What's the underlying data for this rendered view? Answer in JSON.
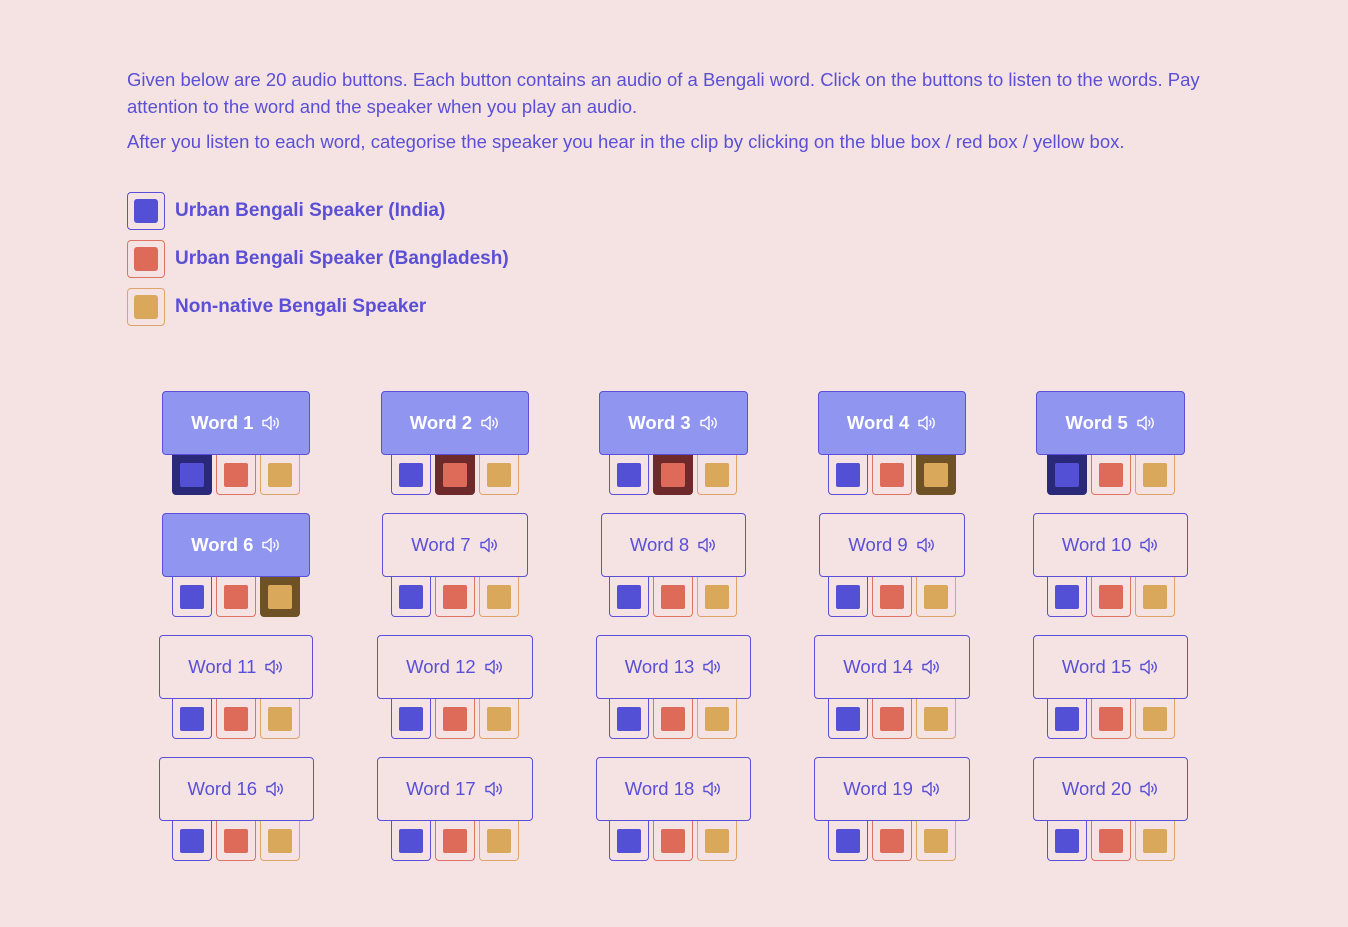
{
  "instructions": {
    "p1": "Given below are 20 audio buttons. Each button contains an audio of a Bengali word. Click on the buttons to listen to the words. Pay attention to the word and the speaker when you play an audio.",
    "p2": "After you listen to each word, categorise the speaker you hear in the clip by clicking on the blue box / red box / yellow box."
  },
  "legend": [
    {
      "label": "Urban Bengali Speaker (India)",
      "color": "#5450d6",
      "border": "#5a4fd6"
    },
    {
      "label": "Urban Bengali Speaker (Bangladesh)",
      "color": "#de6a5a",
      "border": "#e07464"
    },
    {
      "label": "Non-native Bengali Speaker",
      "color": "#d9a85a",
      "border": "#dfa46a"
    }
  ],
  "colors": {
    "played_bg": "#9096ef",
    "accent": "#5a4fd6",
    "background": "#f5e3e3"
  },
  "words": [
    {
      "label": "Word 1",
      "played": true,
      "selected": "blue"
    },
    {
      "label": "Word 2",
      "played": true,
      "selected": "red"
    },
    {
      "label": "Word 3",
      "played": true,
      "selected": "red"
    },
    {
      "label": "Word 4",
      "played": true,
      "selected": "yellow"
    },
    {
      "label": "Word 5",
      "played": true,
      "selected": "blue"
    },
    {
      "label": "Word 6",
      "played": true,
      "selected": "yellow"
    },
    {
      "label": "Word 7",
      "played": false,
      "selected": null
    },
    {
      "label": "Word 8",
      "played": false,
      "selected": null
    },
    {
      "label": "Word 9",
      "played": false,
      "selected": null
    },
    {
      "label": "Word 10",
      "played": false,
      "selected": null
    },
    {
      "label": "Word 11",
      "played": false,
      "selected": null
    },
    {
      "label": "Word 12",
      "played": false,
      "selected": null
    },
    {
      "label": "Word 13",
      "played": false,
      "selected": null
    },
    {
      "label": "Word 14",
      "played": false,
      "selected": null
    },
    {
      "label": "Word 15",
      "played": false,
      "selected": null
    },
    {
      "label": "Word 16",
      "played": false,
      "selected": null
    },
    {
      "label": "Word 17",
      "played": false,
      "selected": null
    },
    {
      "label": "Word 18",
      "played": false,
      "selected": null
    },
    {
      "label": "Word 19",
      "played": false,
      "selected": null
    },
    {
      "label": "Word 20",
      "played": false,
      "selected": null
    }
  ]
}
